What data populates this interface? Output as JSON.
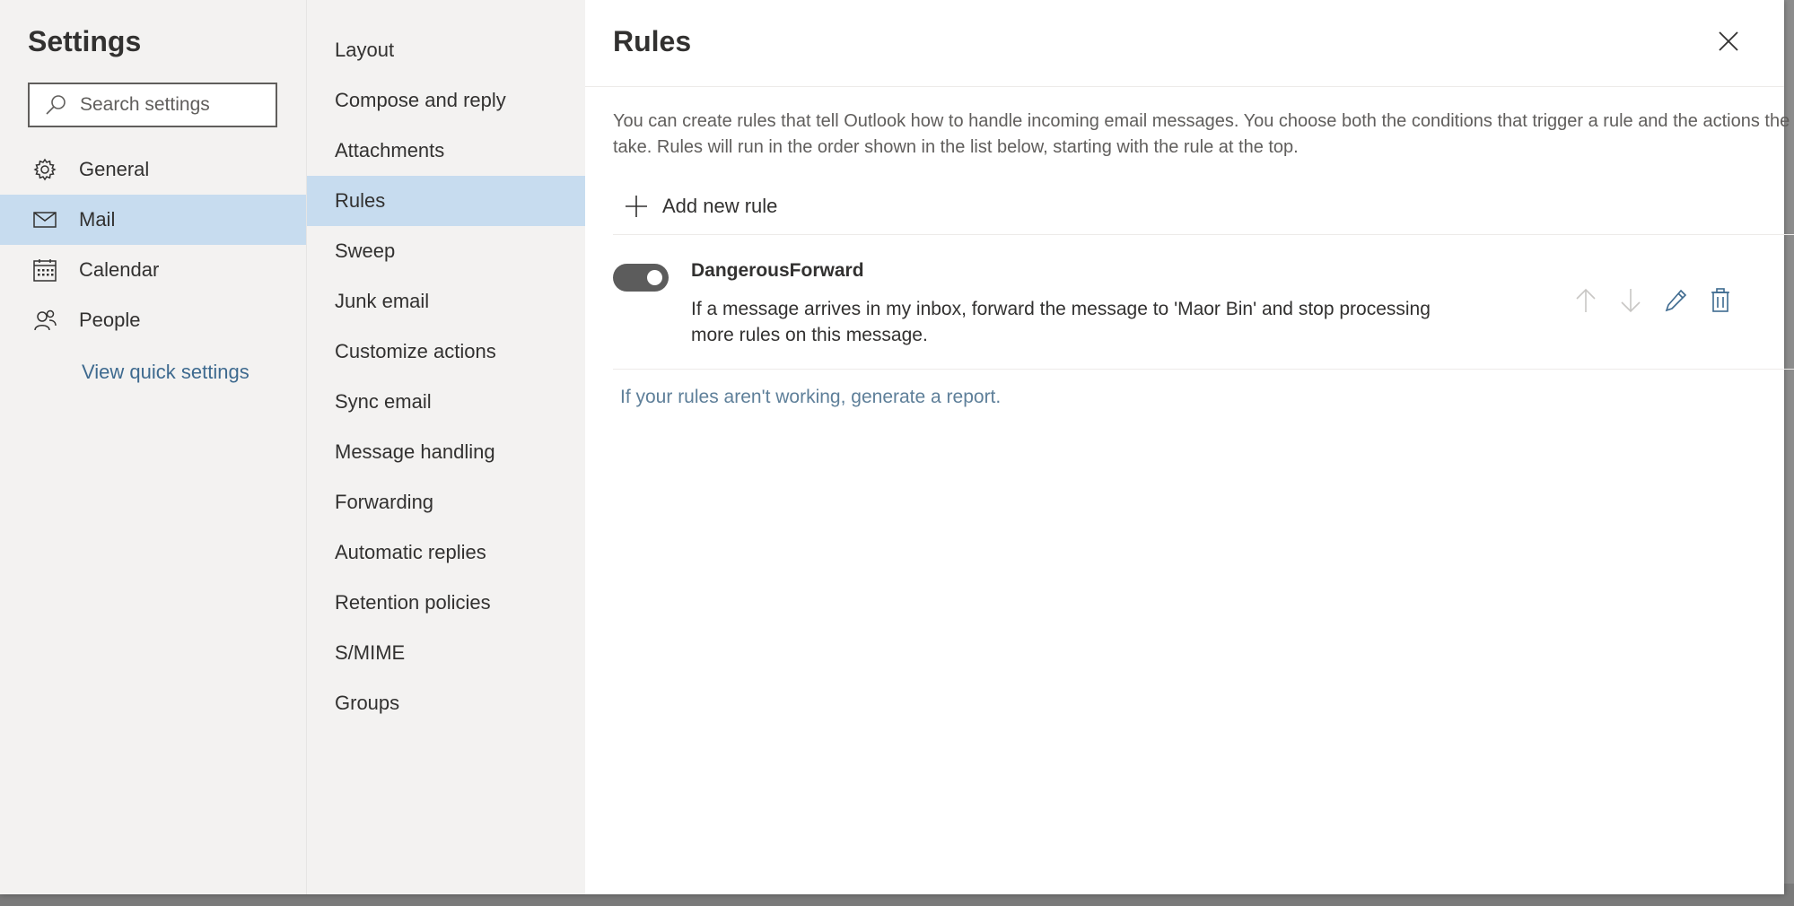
{
  "sidebar": {
    "title": "Settings",
    "search": {
      "placeholder": "Search settings",
      "value": ""
    },
    "items": [
      {
        "label": "General",
        "icon": "gear-icon",
        "selected": false
      },
      {
        "label": "Mail",
        "icon": "mail-icon",
        "selected": true
      },
      {
        "label": "Calendar",
        "icon": "calendar-icon",
        "selected": false
      },
      {
        "label": "People",
        "icon": "people-icon",
        "selected": false
      }
    ],
    "quick_settings_link": "View quick settings"
  },
  "submenu": {
    "items": [
      {
        "label": "Layout",
        "selected": false
      },
      {
        "label": "Compose and reply",
        "selected": false
      },
      {
        "label": "Attachments",
        "selected": false
      },
      {
        "label": "Rules",
        "selected": true
      },
      {
        "label": "Sweep",
        "selected": false
      },
      {
        "label": "Junk email",
        "selected": false
      },
      {
        "label": "Customize actions",
        "selected": false
      },
      {
        "label": "Sync email",
        "selected": false
      },
      {
        "label": "Message handling",
        "selected": false
      },
      {
        "label": "Forwarding",
        "selected": false
      },
      {
        "label": "Automatic replies",
        "selected": false
      },
      {
        "label": "Retention policies",
        "selected": false
      },
      {
        "label": "S/MIME",
        "selected": false
      },
      {
        "label": "Groups",
        "selected": false
      }
    ]
  },
  "main": {
    "title": "Rules",
    "description": "You can create rules that tell Outlook how to handle incoming email messages. You choose both the conditions that trigger a rule and the actions the rule will take. Rules will run in the order shown in the list below, starting with the rule at the top.",
    "add_rule_label": "Add new rule",
    "rules": [
      {
        "name": "DangerousForward",
        "enabled": true,
        "description": "If a message arrives in my inbox, forward the message to 'Maor Bin' and stop processing more rules on this message."
      }
    ],
    "report_link": "If your rules aren't working, generate a report."
  },
  "colors": {
    "selected_bg": "#c7dcef",
    "sidebar_bg": "#f3f2f1",
    "link": "#3e6a8f",
    "toggle_on": "#5c5c5c"
  }
}
